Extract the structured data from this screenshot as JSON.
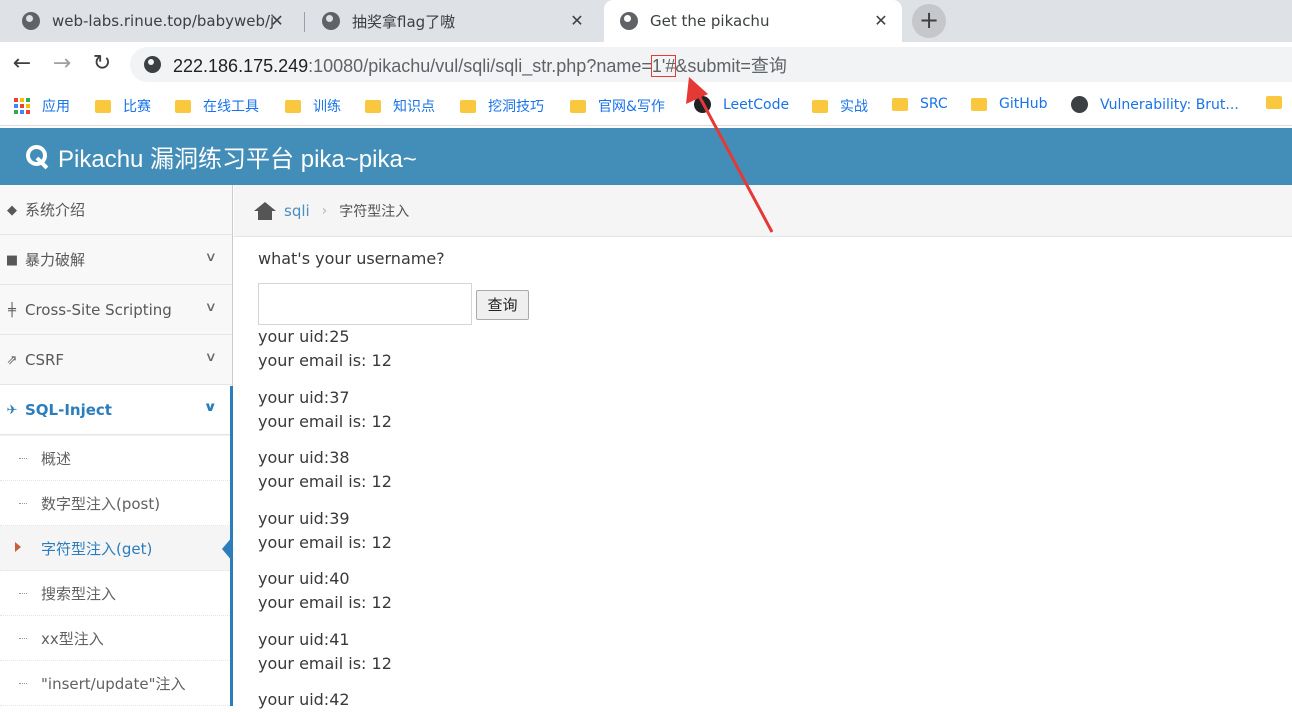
{
  "tabs": [
    {
      "label": "web-labs.rinue.top/babyweb/j"
    },
    {
      "label": "抽奖拿flag了嗷"
    },
    {
      "label": "Get the pikachu"
    }
  ],
  "new_tab": "+",
  "nav": {
    "back": "←",
    "forward": "→",
    "reload": "↻"
  },
  "url": {
    "host": "222.186.175.249",
    "path_prefix": ":10080/pikachu/vul/sqli/sqli_str.php?name=",
    "highlight": "1'#",
    "path_suffix": "&submit=查询"
  },
  "bookmarks": [
    {
      "label": "应用",
      "icon": "apps-icon"
    },
    {
      "label": "比赛",
      "icon": "folder-icon"
    },
    {
      "label": "在线工具",
      "icon": "folder-icon"
    },
    {
      "label": "训练",
      "icon": "folder-icon"
    },
    {
      "label": "知识点",
      "icon": "folder-icon"
    },
    {
      "label": "挖洞技巧",
      "icon": "folder-icon"
    },
    {
      "label": "官网&写作",
      "icon": "folder-icon"
    },
    {
      "label": "LeetCode",
      "icon": "leetcode-icon"
    },
    {
      "label": "实战",
      "icon": "folder-icon"
    },
    {
      "label": "SRC",
      "icon": "folder-icon"
    },
    {
      "label": "GitHub",
      "icon": "folder-icon"
    },
    {
      "label": "Vulnerability: Brut...",
      "icon": "globe-icon"
    }
  ],
  "header": {
    "title": "Pikachu 漏洞练习平台 pika~pika~"
  },
  "sidebar": {
    "items": [
      {
        "label": "系统介绍",
        "icon": "tags-icon"
      },
      {
        "label": "暴力破解",
        "icon": "lock-icon"
      },
      {
        "label": "Cross-Site Scripting",
        "icon": "tree-icon"
      },
      {
        "label": "CSRF",
        "icon": "share-icon"
      },
      {
        "label": "SQL-Inject",
        "icon": "plane-icon"
      }
    ],
    "sub_items": [
      {
        "label": "概述"
      },
      {
        "label": "数字型注入(post)"
      },
      {
        "label": "字符型注入(get)"
      },
      {
        "label": "搜索型注入"
      },
      {
        "label": "xx型注入"
      },
      {
        "label": "\"insert/update\"注入"
      }
    ]
  },
  "breadcrumb": {
    "section": "sqli",
    "current": "字符型注入"
  },
  "main": {
    "question": "what's your username?",
    "input_value": "",
    "button_label": "查询",
    "results": [
      {
        "uid": "your uid:25",
        "email": "your email is: 12"
      },
      {
        "uid": "your uid:37",
        "email": "your email is: 12"
      },
      {
        "uid": "your uid:38",
        "email": "your email is: 12"
      },
      {
        "uid": "your uid:39",
        "email": "your email is: 12"
      },
      {
        "uid": "your uid:40",
        "email": "your email is: 12"
      },
      {
        "uid": "your uid:41",
        "email": "your email is: 12"
      },
      {
        "uid": "your uid:42",
        "email": ""
      }
    ]
  },
  "colors": {
    "header_bg": "#438eb9",
    "accent": "#2b7dbc",
    "annotation": "#e53935"
  }
}
